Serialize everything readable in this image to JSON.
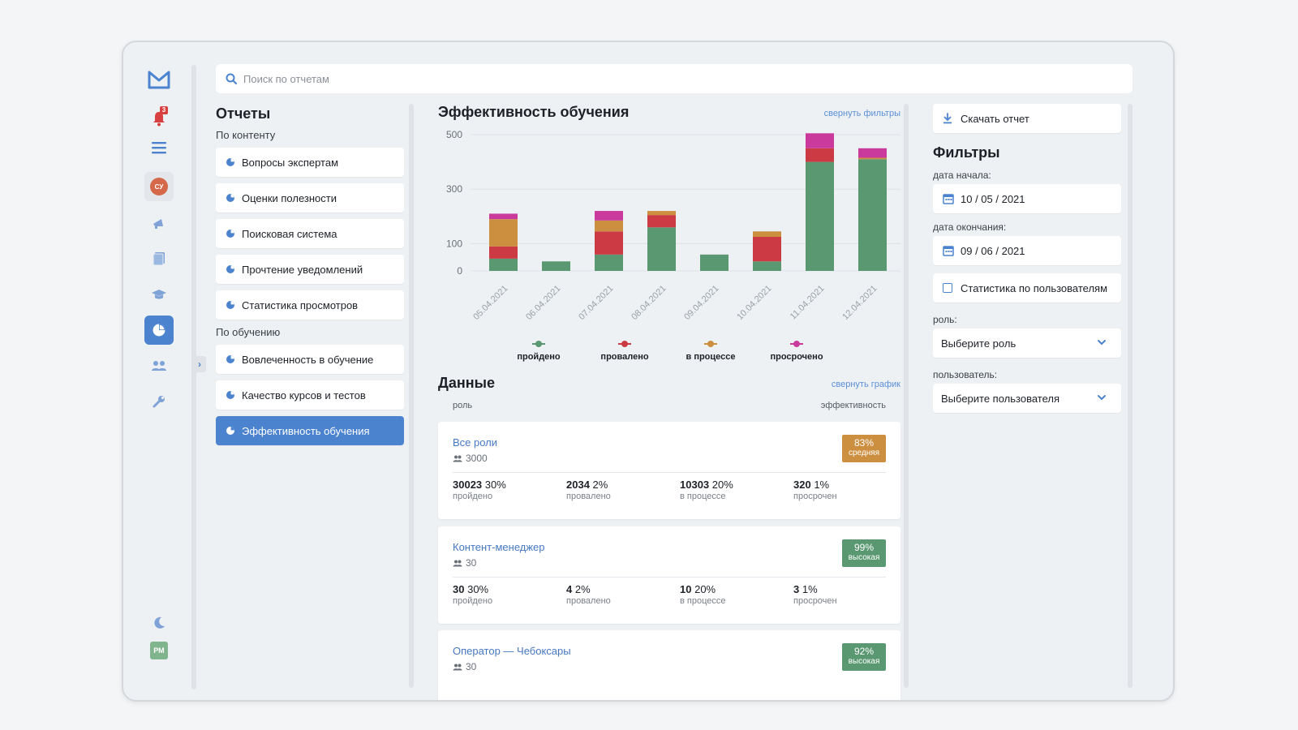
{
  "rail": {
    "bell_count": "3",
    "user_initials": "СУ",
    "profile_initials": "РМ"
  },
  "search": {
    "placeholder": "Поиск по отчетам"
  },
  "reports": {
    "title": "Отчеты",
    "groups": [
      {
        "label": "По контенту",
        "items": [
          "Вопросы экспертам",
          "Оценки полезности",
          "Поисковая система",
          "Прочтение уведомлений",
          "Статистика просмотров"
        ]
      },
      {
        "label": "По обучению",
        "items": [
          "Вовлеченность в обучение",
          "Качество курсов и тестов",
          "Эффективность обучения"
        ]
      }
    ],
    "active_item": "Эффективность обучения"
  },
  "center": {
    "title": "Эффективность обучения",
    "collapse_filters": "свернуть фильтры",
    "data_title": "Данные",
    "collapse_chart": "свернуть график",
    "col_role": "роль",
    "col_eff": "эффективность"
  },
  "chart_data": {
    "type": "bar",
    "stacked": true,
    "categories": [
      "05.04.2021",
      "06.04.2021",
      "07.04.2021",
      "08.04.2021",
      "09.04.2021",
      "10.04.2021",
      "11.04.2021",
      "12.04.2021"
    ],
    "y_ticks": [
      "500",
      "300",
      "100",
      "0"
    ],
    "series": [
      {
        "name": "пройдено",
        "color": "#5a9872",
        "values": [
          45,
          35,
          60,
          160,
          60,
          35,
          400,
          410
        ]
      },
      {
        "name": "провалено",
        "color": "#cc3b44",
        "values": [
          45,
          0,
          85,
          45,
          0,
          90,
          50,
          0
        ]
      },
      {
        "name": "в процессе",
        "color": "#cc8f3f",
        "values": [
          100,
          0,
          40,
          15,
          0,
          20,
          0,
          5
        ]
      },
      {
        "name": "просрочено",
        "color": "#c93a9c",
        "values": [
          20,
          0,
          35,
          0,
          0,
          0,
          55,
          35
        ]
      }
    ]
  },
  "cards": [
    {
      "role": "Все роли",
      "users": "3000",
      "percent": "83%",
      "level": "средняя",
      "badge_color": "#cc8f3f",
      "stats": [
        {
          "n": "30023",
          "p": "30%",
          "l": "пройдено"
        },
        {
          "n": "2034",
          "p": "2%",
          "l": "провалено"
        },
        {
          "n": "10303",
          "p": "20%",
          "l": "в процессе"
        },
        {
          "n": "320",
          "p": "1%",
          "l": "просрочен"
        }
      ]
    },
    {
      "role": "Контент-менеджер",
      "users": "30",
      "percent": "99%",
      "level": "высокая",
      "badge_color": "#5a9872",
      "stats": [
        {
          "n": "30",
          "p": "30%",
          "l": "пройдено"
        },
        {
          "n": "4",
          "p": "2%",
          "l": "провалено"
        },
        {
          "n": "10",
          "p": "20%",
          "l": "в процессе"
        },
        {
          "n": "3",
          "p": "1%",
          "l": "просрочен"
        }
      ]
    },
    {
      "role": "Оператор — Чебоксары",
      "users": "30",
      "percent": "92%",
      "level": "высокая",
      "badge_color": "#5a9872",
      "stats": []
    }
  ],
  "right": {
    "download": "Скачать отчет",
    "filters_title": "Фильтры",
    "start_label": "дата начала:",
    "start_value": "10 / 05 / 2021",
    "end_label": "дата окончания:",
    "end_value": "09 / 06 / 2021",
    "user_stats": "Статистика по пользователям",
    "role_label": "роль:",
    "role_value": "Выберите роль",
    "user_label": "пользователь:",
    "user_value": "Выберите пользователя"
  }
}
